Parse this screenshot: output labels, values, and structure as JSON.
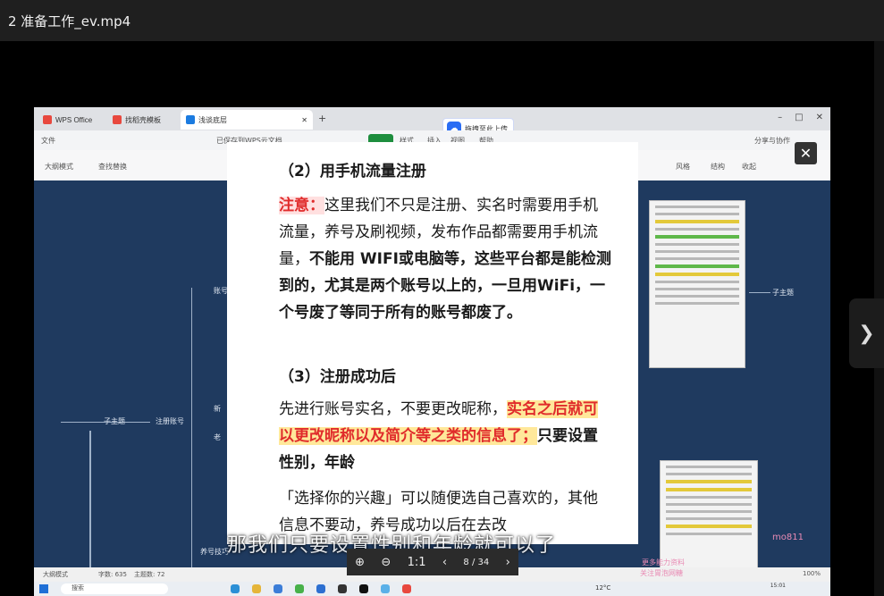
{
  "player": {
    "title": "2 准备工作_ev.mp4",
    "next_icon": "chevron-right-icon",
    "close_icon": "close-icon"
  },
  "wps": {
    "tabs": [
      {
        "label": "WPS Office",
        "color": "#e8483e"
      },
      {
        "label": "找稻壳模板",
        "color": "#e8483e"
      },
      {
        "label": "浅谈底层",
        "color": "#1b7be0"
      }
    ],
    "upload_chip": "拖拽至此上传",
    "menu": {
      "file": "文件",
      "saved": "已保存到WPS云文档",
      "start": "开始",
      "style": "样式",
      "insert": "插入",
      "view": "视图",
      "help": "帮助",
      "share": "分享与协作"
    },
    "toolbar": {
      "outline": "大纲模式",
      "find": "查找替换",
      "style": "风格",
      "structure": "结构",
      "collapse": "收起"
    },
    "mindmap": {
      "root": "子主题",
      "register": "注册账号",
      "account": "账号",
      "new": "新",
      "old": "老",
      "raise": "养号技巧",
      "subtopic": "子主题"
    },
    "status": {
      "outline": "大纲模式",
      "chars": "字数: 635",
      "topics": "主题数: 72",
      "zoom": "100%"
    },
    "taskbar": {
      "search": "搜索",
      "weather": "12°C",
      "time": "15:01"
    }
  },
  "doc": {
    "heading2": "（2）用手机流量注册",
    "note_label": "注意：",
    "p1_text": "这里我们不只是注册、实名时需要用手机流量，养号及刷视频，发布作品都需要用手机流量，",
    "p1_bold": "不能用 WIFI或电脑等，这些平台都是能检测到的，尤其是两个账号以上的，一旦用WiFi，一个号废了等同于所有的账号都废了。",
    "heading3": "（3）注册成功后",
    "p2_text": "先进行账号实名，不要更改昵称，",
    "p2_highlight": "实名之后就可以更改昵称以及简介等之类的信息了；",
    "p2_bold": "只要设置性别，年龄",
    "p3_text": "「选择你的兴趣」可以随便选自己喜欢的，其他信息不要动，养号成功以后在去改"
  },
  "viewer": {
    "page": "8 / 34",
    "zoom_in_icon": "zoom-in-icon",
    "zoom_out_icon": "zoom-out-icon",
    "actual": "1:1"
  },
  "subtitle": "那我们只要设置性别和年龄就可以了",
  "watermarks": {
    "a": "mo811",
    "b": "更多能力资料",
    "c": "关注胃泡网糖"
  }
}
